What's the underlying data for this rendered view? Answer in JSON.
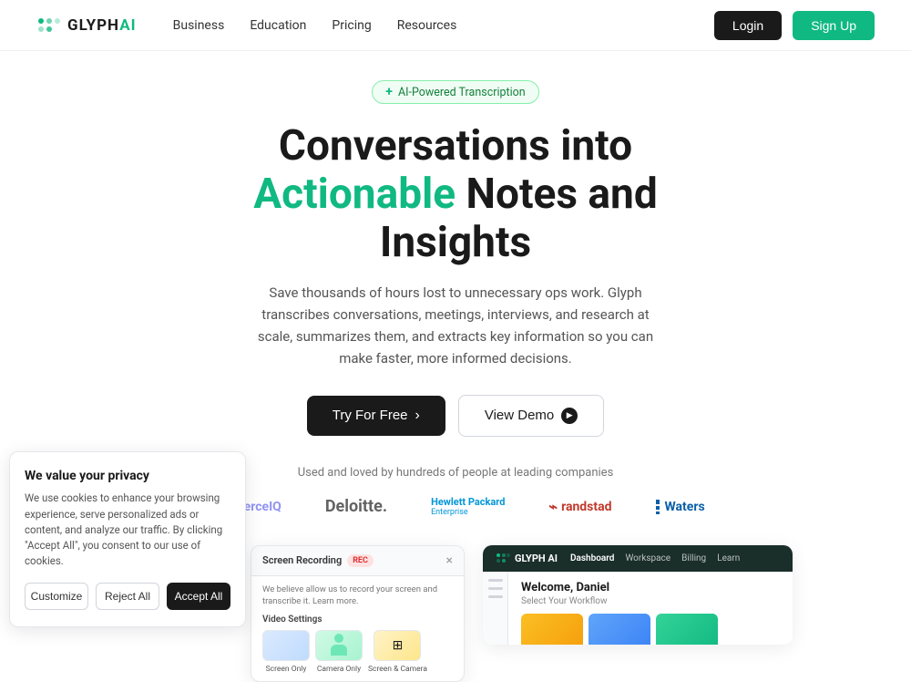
{
  "nav": {
    "logo_text": "GLYPH",
    "logo_ai": "AI",
    "links": [
      {
        "label": "Business",
        "id": "business"
      },
      {
        "label": "Education",
        "id": "education"
      },
      {
        "label": "Pricing",
        "id": "pricing"
      },
      {
        "label": "Resources",
        "id": "resources"
      }
    ],
    "login_label": "Login",
    "signup_label": "Sign Up"
  },
  "hero": {
    "badge_plus": "+",
    "badge_text": "AI-Powered Transcription",
    "title_line1": "Conversations into",
    "title_highlight": "Actionable",
    "title_line2": "Notes and Insights",
    "subtitle": "Save thousands of hours lost to unnecessary ops work. Glyph transcribes conversations, meetings, interviews, and research at scale, summarizes them, and extracts key information so you can make faster, more informed decisions.",
    "try_button": "Try For Free",
    "demo_button": "View Demo"
  },
  "social_proof": {
    "text": "Used and loved by hundreds of people at leading companies",
    "companies": [
      {
        "name": "CommerceIQ",
        "type": "commerce"
      },
      {
        "name": "Deloitte.",
        "type": "deloitte"
      },
      {
        "name": "Hewlett Packard Enterprise",
        "type": "hp"
      },
      {
        "name": "randstad",
        "type": "randstad"
      },
      {
        "name": "Waters",
        "type": "waters"
      }
    ]
  },
  "cookie": {
    "title": "We value your privacy",
    "text": "We use cookies to enhance your browsing experience, serve personalized ads or content, and analyze our traffic. By clicking \"Accept All\", you consent to our use of cookies.",
    "customize_label": "Customize",
    "reject_label": "Reject All",
    "accept_label": "Accept All"
  },
  "screen_recording": {
    "title": "Screen Recording",
    "rec_badge": "REC",
    "description": "We believe allow us to record your screen and transcribe it. Learn more.",
    "video_settings": "Video Settings",
    "options": [
      {
        "label": "Screen Only"
      },
      {
        "label": "Camera Only"
      },
      {
        "label": "Screen & Camera"
      }
    ],
    "close": "×"
  },
  "dashboard": {
    "logo": "GLYPH AI",
    "nav_items": [
      {
        "label": "Dashboard",
        "active": true
      },
      {
        "label": "Workspace",
        "active": false
      },
      {
        "label": "Billing",
        "active": false
      },
      {
        "label": "Learn",
        "active": false
      }
    ],
    "welcome": "Welcome, Daniel",
    "subtitle": "Select Your Workflow"
  }
}
